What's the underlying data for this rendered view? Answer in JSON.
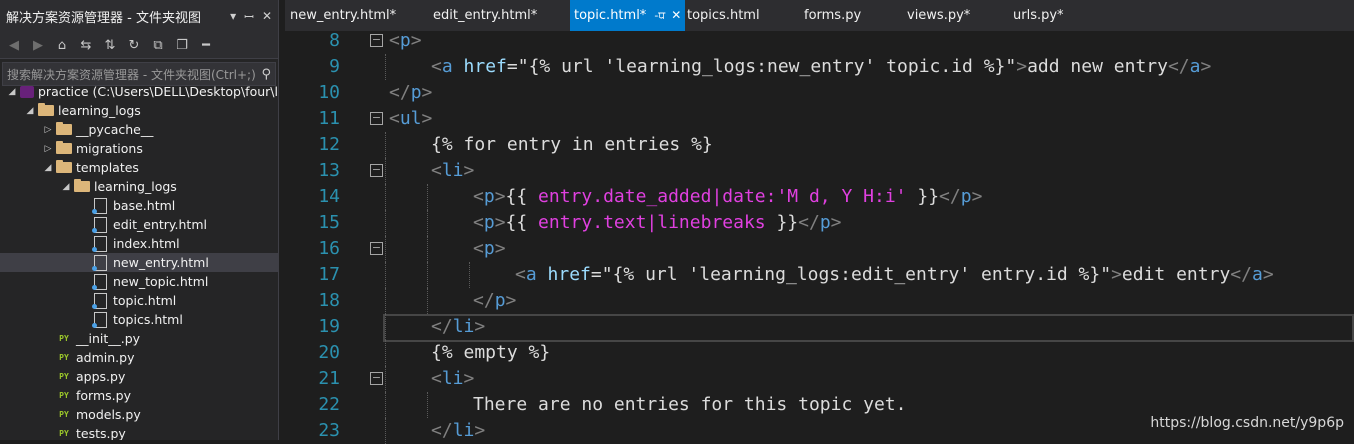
{
  "solution_explorer": {
    "title": "解决方案资源管理器 - 文件夹视图",
    "search_placeholder": "搜索解决方案资源管理器 - 文件夹视图(Ctrl+;)",
    "tree": [
      {
        "label": "practice (C:\\Users\\DELL\\Desktop\\four\\l",
        "icon": "solution-icon",
        "depth": 0,
        "arrow": "down"
      },
      {
        "label": "learning_logs",
        "icon": "folder-icon",
        "depth": 1,
        "arrow": "down"
      },
      {
        "label": "__pycache__",
        "icon": "folder-icon",
        "depth": 2,
        "arrow": "right"
      },
      {
        "label": "migrations",
        "icon": "folder-icon",
        "depth": 2,
        "arrow": "right"
      },
      {
        "label": "templates",
        "icon": "folder-icon",
        "depth": 2,
        "arrow": "down"
      },
      {
        "label": "learning_logs",
        "icon": "folder-icon",
        "depth": 3,
        "arrow": "down"
      },
      {
        "label": "base.html",
        "icon": "html-file-icon",
        "depth": 4
      },
      {
        "label": "edit_entry.html",
        "icon": "html-file-icon",
        "depth": 4
      },
      {
        "label": "index.html",
        "icon": "html-file-icon",
        "depth": 4
      },
      {
        "label": "new_entry.html",
        "icon": "html-file-icon",
        "depth": 4,
        "selected": true
      },
      {
        "label": "new_topic.html",
        "icon": "html-file-icon",
        "depth": 4
      },
      {
        "label": "topic.html",
        "icon": "html-file-icon",
        "depth": 4
      },
      {
        "label": "topics.html",
        "icon": "html-file-icon",
        "depth": 4
      },
      {
        "label": "__init__.py",
        "icon": "python-file-icon",
        "depth": 2
      },
      {
        "label": "admin.py",
        "icon": "python-file-icon",
        "depth": 2
      },
      {
        "label": "apps.py",
        "icon": "python-file-icon",
        "depth": 2
      },
      {
        "label": "forms.py",
        "icon": "python-file-icon",
        "depth": 2
      },
      {
        "label": "models.py",
        "icon": "python-file-icon",
        "depth": 2
      },
      {
        "label": "tests.py",
        "icon": "python-file-icon",
        "depth": 2
      }
    ]
  },
  "tabs": [
    {
      "label": "new_entry.html*"
    },
    {
      "label": "edit_entry.html*"
    },
    {
      "label": "topic.html*",
      "active": true,
      "pin": "-ਧ",
      "close": "✕"
    },
    {
      "label": "topics.html"
    },
    {
      "label": "forms.py"
    },
    {
      "label": "views.py*"
    },
    {
      "label": "urls.py*"
    }
  ],
  "editor": {
    "current_line": 19,
    "lines": [
      {
        "n": 8,
        "fold": true,
        "indent": 0,
        "tokens": [
          [
            "t",
            "<"
          ],
          [
            "tn",
            "p"
          ],
          [
            "t",
            ">"
          ]
        ]
      },
      {
        "n": 9,
        "indent": 1,
        "tokens": [
          [
            "t",
            "<"
          ],
          [
            "tn",
            "a"
          ],
          [
            "w",
            " "
          ],
          [
            "at",
            "href"
          ],
          [
            "w",
            "=\"{% url 'learning_logs:new_entry' topic.id %}\""
          ],
          [
            "t",
            ">"
          ],
          [
            "w",
            "add new entry"
          ],
          [
            "t",
            "</"
          ],
          [
            "tn",
            "a"
          ],
          [
            "t",
            ">"
          ]
        ]
      },
      {
        "n": 10,
        "indent": 0,
        "tokens": [
          [
            "t",
            "</"
          ],
          [
            "tn",
            "p"
          ],
          [
            "t",
            ">"
          ]
        ]
      },
      {
        "n": 11,
        "fold": true,
        "indent": 0,
        "tokens": [
          [
            "t",
            "<"
          ],
          [
            "tn",
            "ul"
          ],
          [
            "t",
            ">"
          ]
        ]
      },
      {
        "n": 12,
        "indent": 1,
        "tokens": [
          [
            "w",
            "{% for entry in entries %}"
          ]
        ]
      },
      {
        "n": 13,
        "fold": true,
        "indent": 1,
        "tokens": [
          [
            "t",
            "<"
          ],
          [
            "tn",
            "li"
          ],
          [
            "t",
            ">"
          ]
        ]
      },
      {
        "n": 14,
        "indent": 2,
        "tokens": [
          [
            "t",
            "<"
          ],
          [
            "tn",
            "p"
          ],
          [
            "t",
            ">"
          ],
          [
            "w",
            "{{ "
          ],
          [
            "m",
            "entry.date_added|date:'M d, Y H:i'"
          ],
          [
            "w",
            " }}"
          ],
          [
            "t",
            "</"
          ],
          [
            "tn",
            "p"
          ],
          [
            "t",
            ">"
          ]
        ]
      },
      {
        "n": 15,
        "indent": 2,
        "tokens": [
          [
            "t",
            "<"
          ],
          [
            "tn",
            "p"
          ],
          [
            "t",
            ">"
          ],
          [
            "w",
            "{{ "
          ],
          [
            "m",
            "entry.text|linebreaks"
          ],
          [
            "w",
            " }}"
          ],
          [
            "t",
            "</"
          ],
          [
            "tn",
            "p"
          ],
          [
            "t",
            ">"
          ]
        ]
      },
      {
        "n": 16,
        "fold": true,
        "indent": 2,
        "tokens": [
          [
            "t",
            "<"
          ],
          [
            "tn",
            "p"
          ],
          [
            "t",
            ">"
          ]
        ]
      },
      {
        "n": 17,
        "indent": 3,
        "tokens": [
          [
            "t",
            "<"
          ],
          [
            "tn",
            "a"
          ],
          [
            "w",
            " "
          ],
          [
            "at",
            "href"
          ],
          [
            "w",
            "=\"{% url 'learning_logs:edit_entry' entry.id %}\""
          ],
          [
            "t",
            ">"
          ],
          [
            "w",
            "edit entry"
          ],
          [
            "t",
            "</"
          ],
          [
            "tn",
            "a"
          ],
          [
            "t",
            ">"
          ]
        ]
      },
      {
        "n": 18,
        "indent": 2,
        "tokens": [
          [
            "t",
            "</"
          ],
          [
            "tn",
            "p"
          ],
          [
            "t",
            ">"
          ]
        ]
      },
      {
        "n": 19,
        "indent": 1,
        "tokens": [
          [
            "t",
            "</"
          ],
          [
            "tn",
            "li"
          ],
          [
            "t",
            ">"
          ]
        ]
      },
      {
        "n": 20,
        "indent": 1,
        "tokens": [
          [
            "w",
            "{% empty %}"
          ]
        ]
      },
      {
        "n": 21,
        "fold": true,
        "indent": 1,
        "tokens": [
          [
            "t",
            "<"
          ],
          [
            "tn",
            "li"
          ],
          [
            "t",
            ">"
          ]
        ]
      },
      {
        "n": 22,
        "indent": 2,
        "tokens": [
          [
            "w",
            "There are no entries for this topic yet."
          ]
        ]
      },
      {
        "n": 23,
        "indent": 1,
        "tokens": [
          [
            "t",
            "</"
          ],
          [
            "tn",
            "li"
          ],
          [
            "t",
            ">"
          ]
        ]
      }
    ]
  },
  "watermark": "https://blog.csdn.net/y9p6p"
}
